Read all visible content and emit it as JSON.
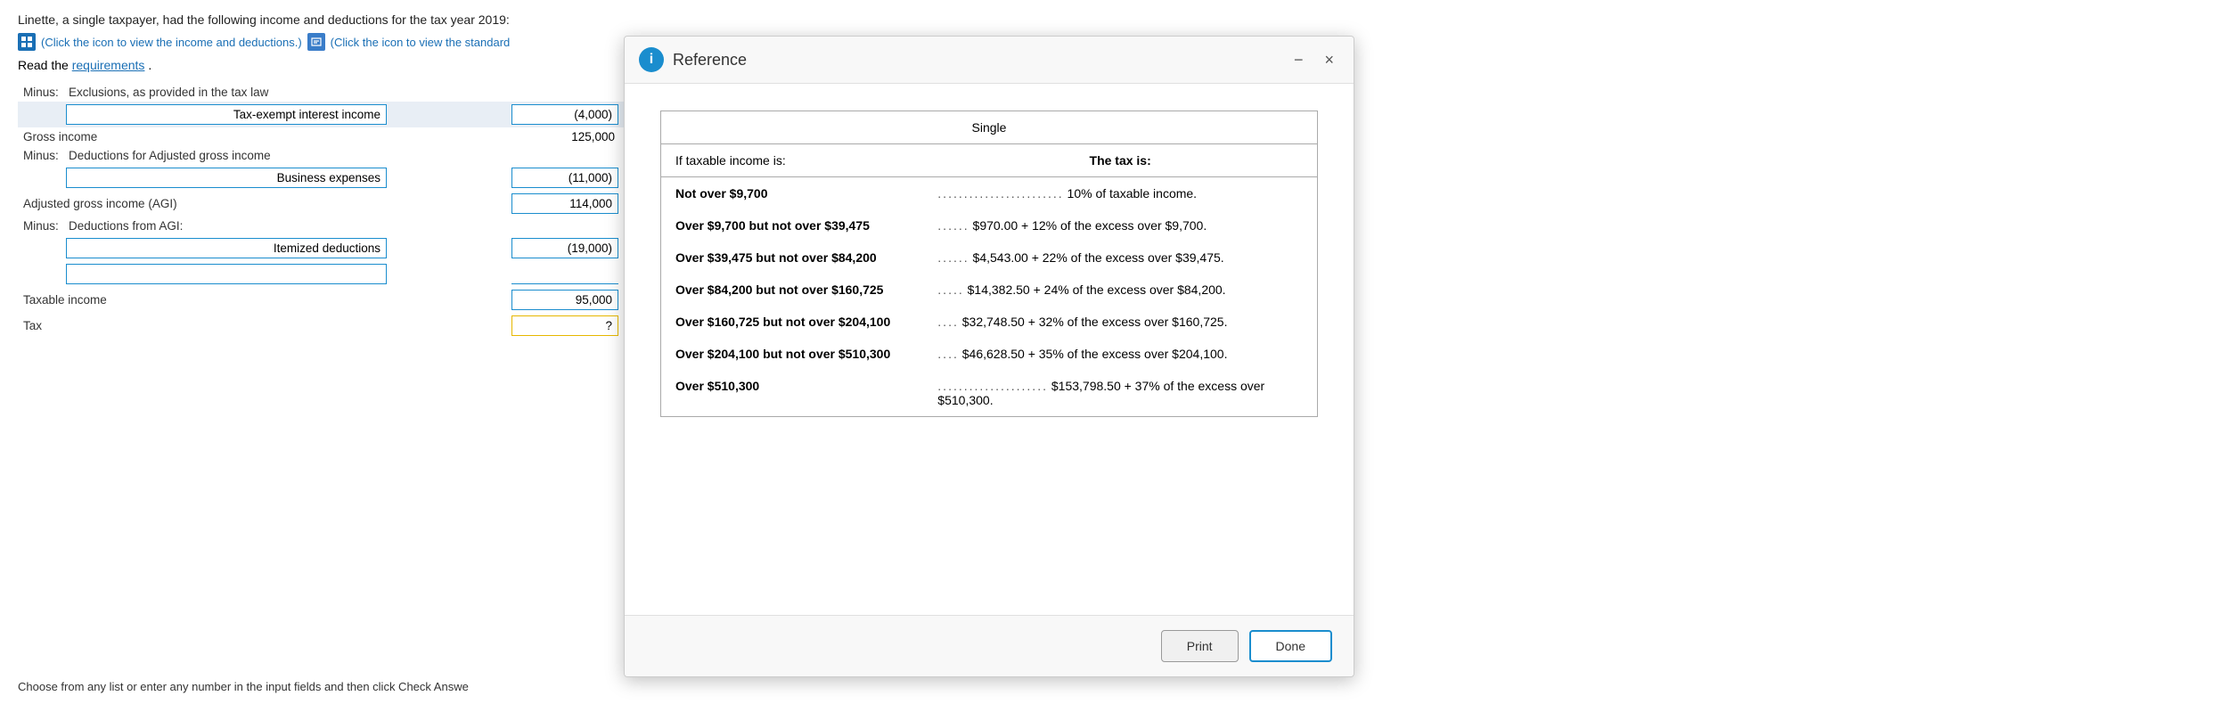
{
  "main": {
    "intro": "Linette, a single taxpayer, had the following income and deductions for the tax year 2019:",
    "icon1_label": "(Click the icon to view the income and deductions.)",
    "icon2_label": "(Click the icon to view the standard",
    "read_label": "Read the",
    "requirements_link": "requirements",
    "period": ".",
    "minus_label": "Minus:",
    "exclusions_label": "Exclusions, as provided in the tax law",
    "tax_exempt_label": "Tax-exempt interest income",
    "tax_exempt_value": "(4,000)",
    "gross_income_label": "Gross income",
    "gross_income_value": "125,000",
    "deductions_agi_label": "Deductions for Adjusted gross income",
    "business_expenses_label": "Business expenses",
    "business_expenses_value": "(11,000)",
    "agi_label": "Adjusted gross income (AGI)",
    "agi_value": "114,000",
    "deductions_from_agi_label": "Deductions from AGI:",
    "itemized_label": "Itemized deductions",
    "itemized_value": "(19,000)",
    "blank_input_value": "",
    "taxable_income_label": "Taxable income",
    "taxable_income_value": "95,000",
    "tax_label": "Tax",
    "tax_value": "?",
    "bottom_note": "Choose from any list or enter any number in the input fields and then click Check Answe"
  },
  "reference": {
    "title": "Reference",
    "info_icon": "i",
    "minimize_icon": "−",
    "close_icon": "×",
    "table": {
      "column1_header": "If taxable income is:",
      "column2_header": "The tax is:",
      "single_header": "Single",
      "rows": [
        {
          "income_range": "Not over $9,700",
          "dots": "........................",
          "tax_formula": "10% of taxable income."
        },
        {
          "income_range": "Over $9,700 but not over $39,475",
          "dots": "......",
          "tax_formula": "$970.00 + 12% of the excess over $9,700."
        },
        {
          "income_range": "Over $39,475 but not over $84,200",
          "dots": "......",
          "tax_formula": "$4,543.00 + 22% of the excess over $39,475."
        },
        {
          "income_range": "Over $84,200 but not over $160,725",
          "dots": ".....",
          "tax_formula": "$14,382.50 + 24% of the excess over $84,200."
        },
        {
          "income_range": "Over $160,725 but not over $204,100",
          "dots": "....",
          "tax_formula": "$32,748.50 + 32% of the excess over $160,725."
        },
        {
          "income_range": "Over $204,100 but not over $510,300",
          "dots": "....",
          "tax_formula": "$46,628.50 + 35% of the excess over $204,100."
        },
        {
          "income_range": "Over $510,300",
          "dots": ".....................",
          "tax_formula": "$153,798.50 + 37% of the excess over $510,300."
        }
      ]
    },
    "print_label": "Print",
    "done_label": "Done"
  }
}
